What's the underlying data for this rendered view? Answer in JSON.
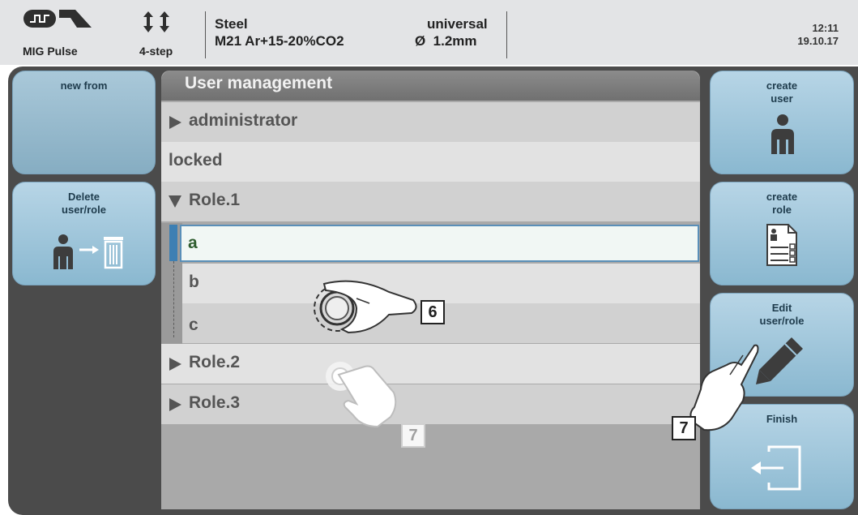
{
  "status_bar": {
    "process_mode": "MIG Pulse",
    "trigger_mode": "4-step",
    "material": "Steel",
    "gas": "M21 Ar+15-20%CO2",
    "characteristic": "universal",
    "wire_diameter": "Ø  1.2mm",
    "time": "12:11",
    "date": "19.10.17"
  },
  "left_buttons": {
    "new_from": "new from",
    "delete_line1": "Delete",
    "delete_line2": "user/role"
  },
  "panel": {
    "title": "User management",
    "rows": [
      {
        "label": "administrator"
      },
      {
        "label": "locked"
      },
      {
        "label": "Role.1"
      },
      {
        "label": "a"
      },
      {
        "label": "b"
      },
      {
        "label": "c"
      },
      {
        "label": "Role.2"
      },
      {
        "label": "Role.3"
      }
    ]
  },
  "right_buttons": {
    "create_user_1": "create",
    "create_user_2": "user",
    "create_role_1": "create",
    "create_role_2": "role",
    "edit_1": "Edit",
    "edit_2": "user/role",
    "finish": "Finish"
  },
  "callouts": {
    "dial": "6",
    "tap_list": "7",
    "tap_edit": "7"
  },
  "colors": {
    "button_blue": "#9cc4da",
    "selected_row": "#f0f7f4",
    "selected_text": "#2f5d2f",
    "selection_bar": "#3d7fb3"
  }
}
